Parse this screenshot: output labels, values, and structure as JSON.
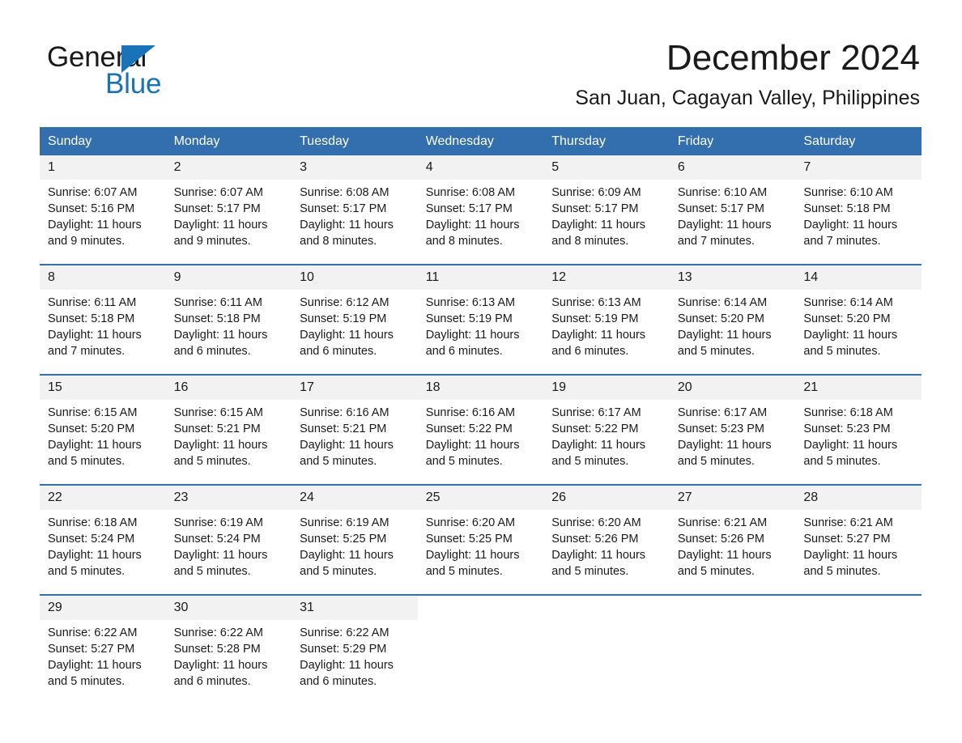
{
  "brand": {
    "name_line1": "General",
    "name_line2": "Blue",
    "logo_icon": "triangle-icon",
    "accent_color": "#1973b8"
  },
  "header": {
    "month_title": "December 2024",
    "location": "San Juan, Cagayan Valley, Philippines"
  },
  "calendar": {
    "header_color": "#336fae",
    "daynum_bg": "#f2f2f2",
    "weekday_headers": [
      "Sunday",
      "Monday",
      "Tuesday",
      "Wednesday",
      "Thursday",
      "Friday",
      "Saturday"
    ],
    "weeks": [
      [
        {
          "day": "1",
          "sunrise": "Sunrise: 6:07 AM",
          "sunset": "Sunset: 5:16 PM",
          "daylight": "Daylight: 11 hours and 9 minutes."
        },
        {
          "day": "2",
          "sunrise": "Sunrise: 6:07 AM",
          "sunset": "Sunset: 5:17 PM",
          "daylight": "Daylight: 11 hours and 9 minutes."
        },
        {
          "day": "3",
          "sunrise": "Sunrise: 6:08 AM",
          "sunset": "Sunset: 5:17 PM",
          "daylight": "Daylight: 11 hours and 8 minutes."
        },
        {
          "day": "4",
          "sunrise": "Sunrise: 6:08 AM",
          "sunset": "Sunset: 5:17 PM",
          "daylight": "Daylight: 11 hours and 8 minutes."
        },
        {
          "day": "5",
          "sunrise": "Sunrise: 6:09 AM",
          "sunset": "Sunset: 5:17 PM",
          "daylight": "Daylight: 11 hours and 8 minutes."
        },
        {
          "day": "6",
          "sunrise": "Sunrise: 6:10 AM",
          "sunset": "Sunset: 5:17 PM",
          "daylight": "Daylight: 11 hours and 7 minutes."
        },
        {
          "day": "7",
          "sunrise": "Sunrise: 6:10 AM",
          "sunset": "Sunset: 5:18 PM",
          "daylight": "Daylight: 11 hours and 7 minutes."
        }
      ],
      [
        {
          "day": "8",
          "sunrise": "Sunrise: 6:11 AM",
          "sunset": "Sunset: 5:18 PM",
          "daylight": "Daylight: 11 hours and 7 minutes."
        },
        {
          "day": "9",
          "sunrise": "Sunrise: 6:11 AM",
          "sunset": "Sunset: 5:18 PM",
          "daylight": "Daylight: 11 hours and 6 minutes."
        },
        {
          "day": "10",
          "sunrise": "Sunrise: 6:12 AM",
          "sunset": "Sunset: 5:19 PM",
          "daylight": "Daylight: 11 hours and 6 minutes."
        },
        {
          "day": "11",
          "sunrise": "Sunrise: 6:13 AM",
          "sunset": "Sunset: 5:19 PM",
          "daylight": "Daylight: 11 hours and 6 minutes."
        },
        {
          "day": "12",
          "sunrise": "Sunrise: 6:13 AM",
          "sunset": "Sunset: 5:19 PM",
          "daylight": "Daylight: 11 hours and 6 minutes."
        },
        {
          "day": "13",
          "sunrise": "Sunrise: 6:14 AM",
          "sunset": "Sunset: 5:20 PM",
          "daylight": "Daylight: 11 hours and 5 minutes."
        },
        {
          "day": "14",
          "sunrise": "Sunrise: 6:14 AM",
          "sunset": "Sunset: 5:20 PM",
          "daylight": "Daylight: 11 hours and 5 minutes."
        }
      ],
      [
        {
          "day": "15",
          "sunrise": "Sunrise: 6:15 AM",
          "sunset": "Sunset: 5:20 PM",
          "daylight": "Daylight: 11 hours and 5 minutes."
        },
        {
          "day": "16",
          "sunrise": "Sunrise: 6:15 AM",
          "sunset": "Sunset: 5:21 PM",
          "daylight": "Daylight: 11 hours and 5 minutes."
        },
        {
          "day": "17",
          "sunrise": "Sunrise: 6:16 AM",
          "sunset": "Sunset: 5:21 PM",
          "daylight": "Daylight: 11 hours and 5 minutes."
        },
        {
          "day": "18",
          "sunrise": "Sunrise: 6:16 AM",
          "sunset": "Sunset: 5:22 PM",
          "daylight": "Daylight: 11 hours and 5 minutes."
        },
        {
          "day": "19",
          "sunrise": "Sunrise: 6:17 AM",
          "sunset": "Sunset: 5:22 PM",
          "daylight": "Daylight: 11 hours and 5 minutes."
        },
        {
          "day": "20",
          "sunrise": "Sunrise: 6:17 AM",
          "sunset": "Sunset: 5:23 PM",
          "daylight": "Daylight: 11 hours and 5 minutes."
        },
        {
          "day": "21",
          "sunrise": "Sunrise: 6:18 AM",
          "sunset": "Sunset: 5:23 PM",
          "daylight": "Daylight: 11 hours and 5 minutes."
        }
      ],
      [
        {
          "day": "22",
          "sunrise": "Sunrise: 6:18 AM",
          "sunset": "Sunset: 5:24 PM",
          "daylight": "Daylight: 11 hours and 5 minutes."
        },
        {
          "day": "23",
          "sunrise": "Sunrise: 6:19 AM",
          "sunset": "Sunset: 5:24 PM",
          "daylight": "Daylight: 11 hours and 5 minutes."
        },
        {
          "day": "24",
          "sunrise": "Sunrise: 6:19 AM",
          "sunset": "Sunset: 5:25 PM",
          "daylight": "Daylight: 11 hours and 5 minutes."
        },
        {
          "day": "25",
          "sunrise": "Sunrise: 6:20 AM",
          "sunset": "Sunset: 5:25 PM",
          "daylight": "Daylight: 11 hours and 5 minutes."
        },
        {
          "day": "26",
          "sunrise": "Sunrise: 6:20 AM",
          "sunset": "Sunset: 5:26 PM",
          "daylight": "Daylight: 11 hours and 5 minutes."
        },
        {
          "day": "27",
          "sunrise": "Sunrise: 6:21 AM",
          "sunset": "Sunset: 5:26 PM",
          "daylight": "Daylight: 11 hours and 5 minutes."
        },
        {
          "day": "28",
          "sunrise": "Sunrise: 6:21 AM",
          "sunset": "Sunset: 5:27 PM",
          "daylight": "Daylight: 11 hours and 5 minutes."
        }
      ],
      [
        {
          "day": "29",
          "sunrise": "Sunrise: 6:22 AM",
          "sunset": "Sunset: 5:27 PM",
          "daylight": "Daylight: 11 hours and 5 minutes."
        },
        {
          "day": "30",
          "sunrise": "Sunrise: 6:22 AM",
          "sunset": "Sunset: 5:28 PM",
          "daylight": "Daylight: 11 hours and 6 minutes."
        },
        {
          "day": "31",
          "sunrise": "Sunrise: 6:22 AM",
          "sunset": "Sunset: 5:29 PM",
          "daylight": "Daylight: 11 hours and 6 minutes."
        },
        null,
        null,
        null,
        null
      ]
    ]
  }
}
